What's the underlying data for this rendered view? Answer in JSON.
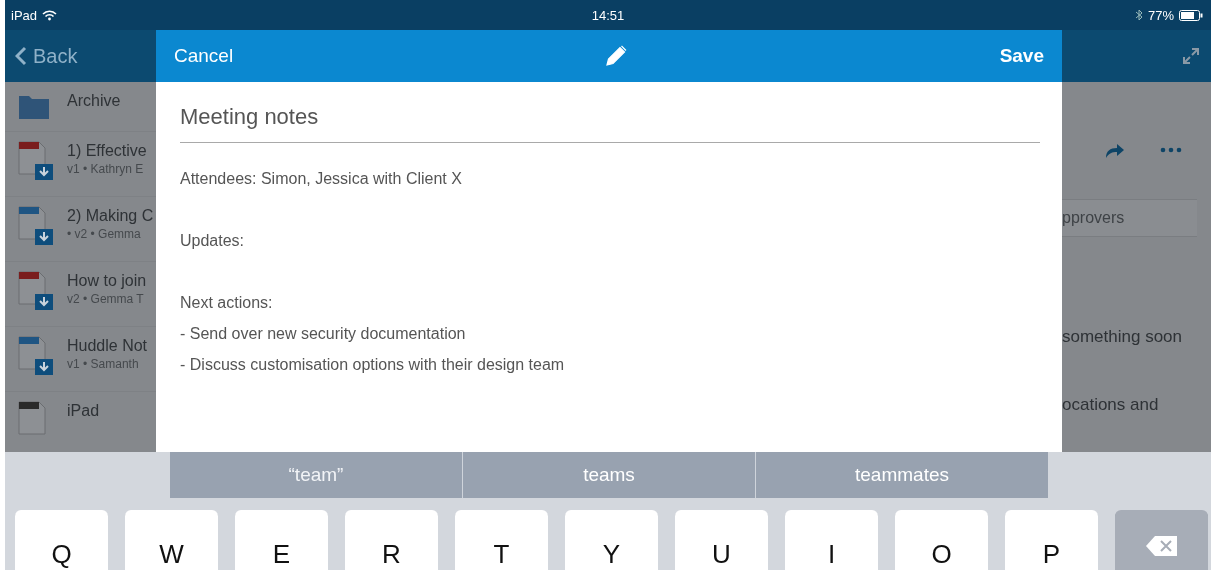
{
  "status_bar": {
    "device": "iPad",
    "time": "14:51",
    "battery": "77%"
  },
  "nav": {
    "back": "Back"
  },
  "files": [
    {
      "kind": "folder",
      "name": "Archive"
    },
    {
      "kind": "pdf",
      "name": "1) Effective",
      "meta": "v1 • Kathryn E",
      "download": true
    },
    {
      "kind": "word",
      "name": "2) Making C",
      "meta": "• v2 • Gemma",
      "download": true
    },
    {
      "kind": "pdf",
      "name": "How to join",
      "meta": "v2 • Gemma T",
      "download": true
    },
    {
      "kind": "word",
      "name": "Huddle Not",
      "meta": "v1 • Samanth",
      "download": true
    },
    {
      "kind": "plain",
      "name": "iPad"
    }
  ],
  "detail": {
    "field": "pprovers",
    "lines": [
      "something soon",
      "ocations and"
    ]
  },
  "modal": {
    "cancel": "Cancel",
    "save": "Save",
    "title": "Meeting notes",
    "body": [
      {
        "lines": [
          "Attendees: Simon, Jessica with Client X"
        ]
      },
      {
        "lines": [
          "Updates:"
        ]
      },
      {
        "lines": [
          "Next actions:",
          "- Send over new security documentation",
          "- Discuss customisation options with their design team"
        ]
      }
    ]
  },
  "keyboard": {
    "suggestions": [
      {
        "text": "“team”",
        "kind": "literal"
      },
      {
        "text": "teams",
        "kind": "word"
      },
      {
        "text": "teammates",
        "kind": "word"
      }
    ],
    "keys": [
      "Q",
      "W",
      "E",
      "R",
      "T",
      "Y",
      "U",
      "I",
      "O",
      "P"
    ]
  }
}
